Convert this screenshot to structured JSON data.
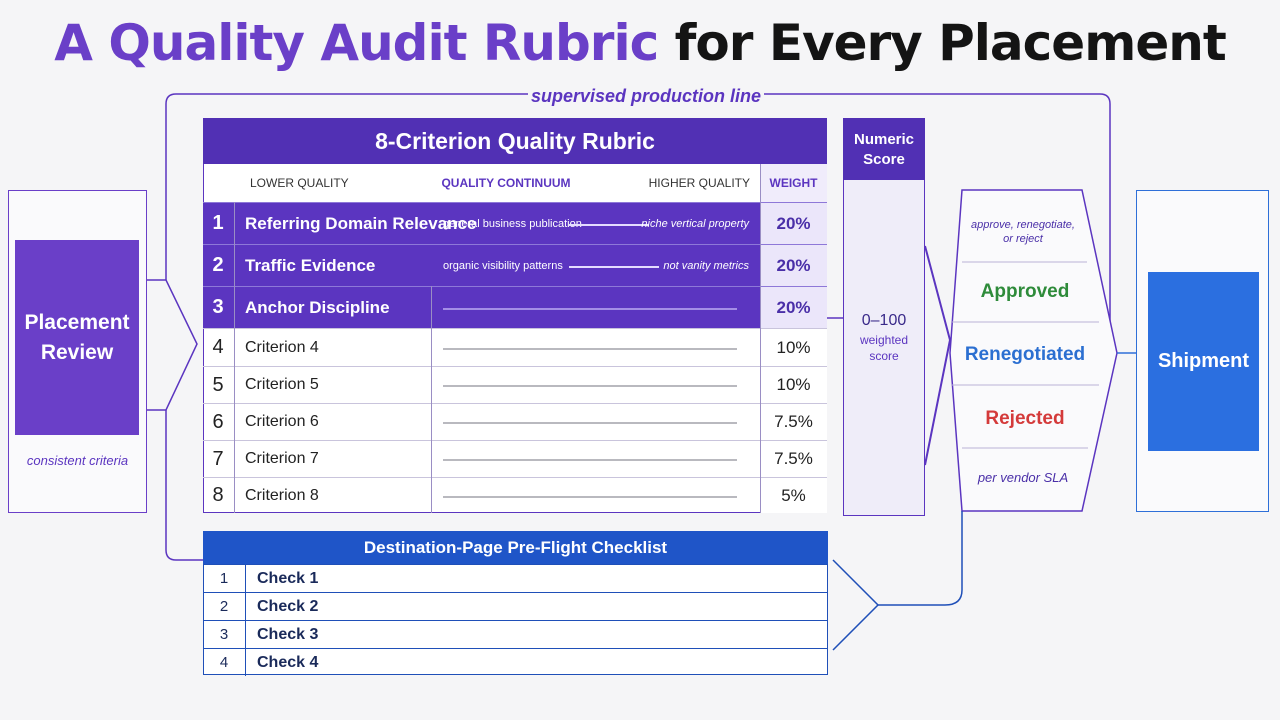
{
  "title": {
    "part1": "A Quality Audit Rubric",
    "part2": " for Every Placement"
  },
  "loop_label": "supervised production line",
  "placement_review": {
    "label": "Placement\nReview",
    "footnote": "consistent criteria"
  },
  "rubric": {
    "title": "8-Criterion Quality Rubric",
    "headers": {
      "lower": "LOWER QUALITY",
      "continuum": "QUALITY CONTINUUM",
      "higher": "HIGHER QUALITY",
      "weight": "WEIGHT"
    },
    "criteria": [
      {
        "num": "1",
        "name": "Referring Domain Relevance",
        "low_label": "general business publication",
        "high_label": "niche vertical property",
        "weight": "20%",
        "highlighted": true
      },
      {
        "num": "2",
        "name": "Traffic Evidence",
        "low_label": "organic visibility patterns",
        "high_label": "not vanity metrics",
        "weight": "20%",
        "highlighted": true
      },
      {
        "num": "3",
        "name": "Anchor Discipline",
        "weight": "20%",
        "highlighted": true
      },
      {
        "num": "4",
        "name": "Criterion 4",
        "weight": "10%"
      },
      {
        "num": "5",
        "name": "Criterion 5",
        "weight": "10%"
      },
      {
        "num": "6",
        "name": "Criterion 6",
        "weight": "7.5%"
      },
      {
        "num": "7",
        "name": "Criterion 7",
        "weight": "7.5%"
      },
      {
        "num": "8",
        "name": "Criterion 8",
        "weight": "5%"
      }
    ]
  },
  "numeric_score": {
    "title": "Numeric\nScore",
    "value": "0–100",
    "subtitle": "weighted\nscore"
  },
  "decision": {
    "note": "approve, renegotiate,\nor reject",
    "outcomes": {
      "approved": "Approved",
      "renegotiated": "Renegotiated",
      "rejected": "Rejected"
    },
    "footnote": "per vendor SLA",
    "colors": {
      "approved": "#2e8b3a",
      "renegotiated": "#2b6fd1",
      "rejected": "#d43a3a"
    }
  },
  "shipment": {
    "label": "Shipment"
  },
  "checklist": {
    "title": "Destination-Page Pre-Flight Checklist",
    "items": [
      {
        "num": "1",
        "label": "Check 1"
      },
      {
        "num": "2",
        "label": "Check 2"
      },
      {
        "num": "3",
        "label": "Check 3"
      },
      {
        "num": "4",
        "label": "Check 4"
      }
    ]
  },
  "colors": {
    "purple": "#6a3fc8",
    "purple_dark": "#5130b4",
    "blue": "#2b6fe0",
    "navy": "#1f55c8"
  }
}
